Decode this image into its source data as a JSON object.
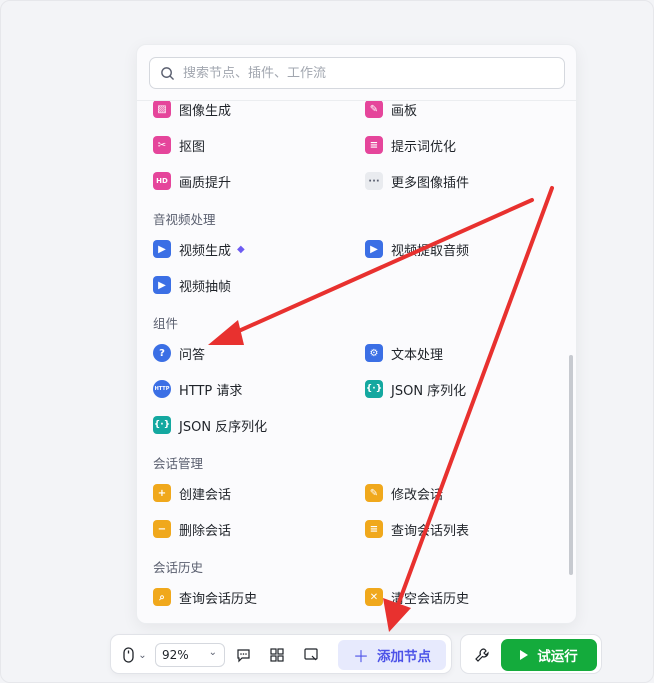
{
  "search": {
    "placeholder": "搜索节点、插件、工作流"
  },
  "image_items": [
    {
      "label": "图像生成"
    },
    {
      "label": "画板"
    },
    {
      "label": "抠图"
    },
    {
      "label": "提示词优化"
    },
    {
      "label": "画质提升"
    },
    {
      "label": "更多图像插件"
    }
  ],
  "sections": {
    "audio_video": "音视频处理",
    "components": "组件",
    "session_mgmt": "会话管理",
    "session_history": "会话历史"
  },
  "audio_video_items": [
    {
      "label": "视频生成"
    },
    {
      "label": "视频提取音频"
    },
    {
      "label": "视频抽帧"
    }
  ],
  "component_items": [
    {
      "label": "问答"
    },
    {
      "label": "文本处理"
    },
    {
      "label": "HTTP 请求"
    },
    {
      "label": "JSON 序列化"
    },
    {
      "label": "JSON 反序列化"
    }
  ],
  "session_items": [
    {
      "label": "创建会话"
    },
    {
      "label": "修改会话"
    },
    {
      "label": "删除会话"
    },
    {
      "label": "查询会话列表"
    }
  ],
  "history_items": [
    {
      "label": "查询会话历史"
    },
    {
      "label": "清空会话历史"
    }
  ],
  "toolbar": {
    "zoom": "92%",
    "add_node": "添加节点",
    "run": "试运行"
  },
  "colors": {
    "accent": "#4d53e8",
    "run_green": "#14ab3c",
    "annotation_arrow": "#e8312f"
  }
}
